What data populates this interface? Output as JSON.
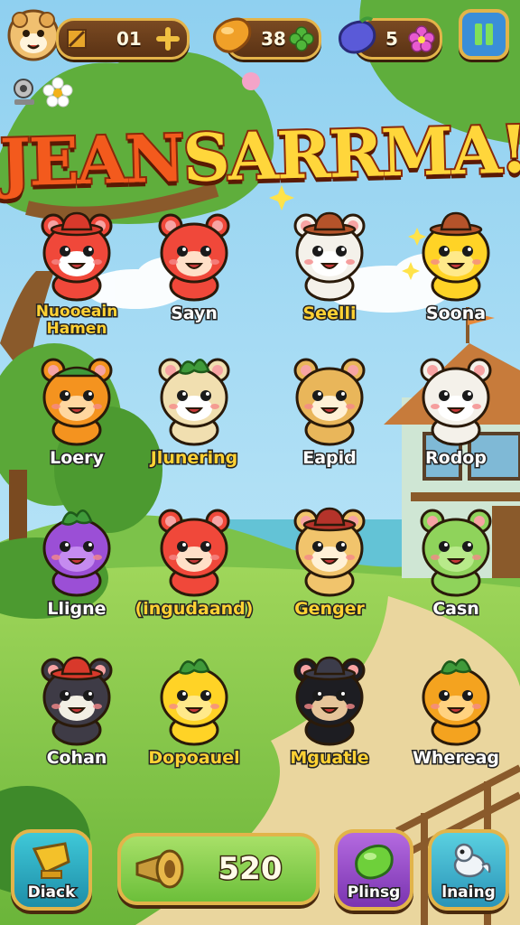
{
  "hud": {
    "player_level": "01",
    "bean_count": "38",
    "gem_count": "5",
    "pause_icon": "pause-icon"
  },
  "title": {
    "part1": "JEAN",
    "part2": "SARRMA!"
  },
  "characters": [
    {
      "name": "Nuooeain\nHamen",
      "kind": "red-fox-hat",
      "color": "#f0483a",
      "accent": "#ffffff",
      "hat": "#d8392b",
      "name_style": "gold"
    },
    {
      "name": "Sayn",
      "kind": "red-fox",
      "color": "#f0483a",
      "accent": "#ffe0c8",
      "hat": "",
      "name_style": "white"
    },
    {
      "name": "Seelli",
      "kind": "white-bear-hat",
      "color": "#f4f1ea",
      "accent": "#ffffff",
      "hat": "#b5532a",
      "name_style": "gold"
    },
    {
      "name": "Soona",
      "kind": "yellow-chick-hat",
      "color": "#ffd326",
      "accent": "#ffe98a",
      "hat": "#b5532a",
      "name_style": "white"
    },
    {
      "name": "Loery",
      "kind": "orange-cat-cap",
      "color": "#f4931f",
      "accent": "#ffd7a0",
      "hat": "#3f9a3a",
      "name_style": "white"
    },
    {
      "name": "Jlunering",
      "kind": "pineapple-hamster",
      "color": "#f1dfb0",
      "accent": "#ffffff",
      "hat": "#3f9a3a",
      "name_style": "gold"
    },
    {
      "name": "Eapid",
      "kind": "tan-hamster",
      "color": "#e9b65a",
      "accent": "#fff1d6",
      "hat": "",
      "name_style": "white"
    },
    {
      "name": "Rodop",
      "kind": "white-bear",
      "color": "#f4f1ea",
      "accent": "#ffffff",
      "hat": "",
      "name_style": "white"
    },
    {
      "name": "Lligne",
      "kind": "purple-blob-leaf",
      "color": "#9b4fd6",
      "accent": "#c58bf0",
      "hat": "#3f9a3a",
      "name_style": "white"
    },
    {
      "name": "(ingudaand)",
      "kind": "red-fox",
      "color": "#f0483a",
      "accent": "#ffe0c8",
      "hat": "",
      "name_style": "gold"
    },
    {
      "name": "Genger",
      "kind": "tan-hamster-hat",
      "color": "#f1c46c",
      "accent": "#fff1d6",
      "hat": "#b5332a",
      "name_style": "gold"
    },
    {
      "name": "Casn",
      "kind": "green-bear",
      "color": "#8fd35b",
      "accent": "#b8ea8a",
      "hat": "",
      "name_style": "white"
    },
    {
      "name": "Cohan",
      "kind": "dark-skunk-hat",
      "color": "#3e3b46",
      "accent": "#f2efe4",
      "hat": "#d8392b",
      "name_style": "white"
    },
    {
      "name": "Dopoauel",
      "kind": "yellow-fruit-leaf",
      "color": "#ffd326",
      "accent": "#ffe98a",
      "hat": "#3f9a3a",
      "name_style": "gold"
    },
    {
      "name": "Mguatle",
      "kind": "black-bear-hat",
      "color": "#1d1d22",
      "accent": "#e6c49a",
      "hat": "#3c3c4a",
      "name_style": "gold"
    },
    {
      "name": "Whereag",
      "kind": "orange-fruit-leaf",
      "color": "#f4a31f",
      "accent": "#ffd280",
      "hat": "#3f9a3a",
      "name_style": "white"
    }
  ],
  "bottom_bar": {
    "left_button": "Diack",
    "score": "520",
    "play_button": "Plinsg",
    "right_button": "lnaing"
  },
  "colors": {
    "sky": "#9ed9f3",
    "grass": "#86c84a",
    "path": "#e9d39a",
    "ui_gold": "#e2b44a",
    "ui_brown": "#6b3d1a"
  }
}
